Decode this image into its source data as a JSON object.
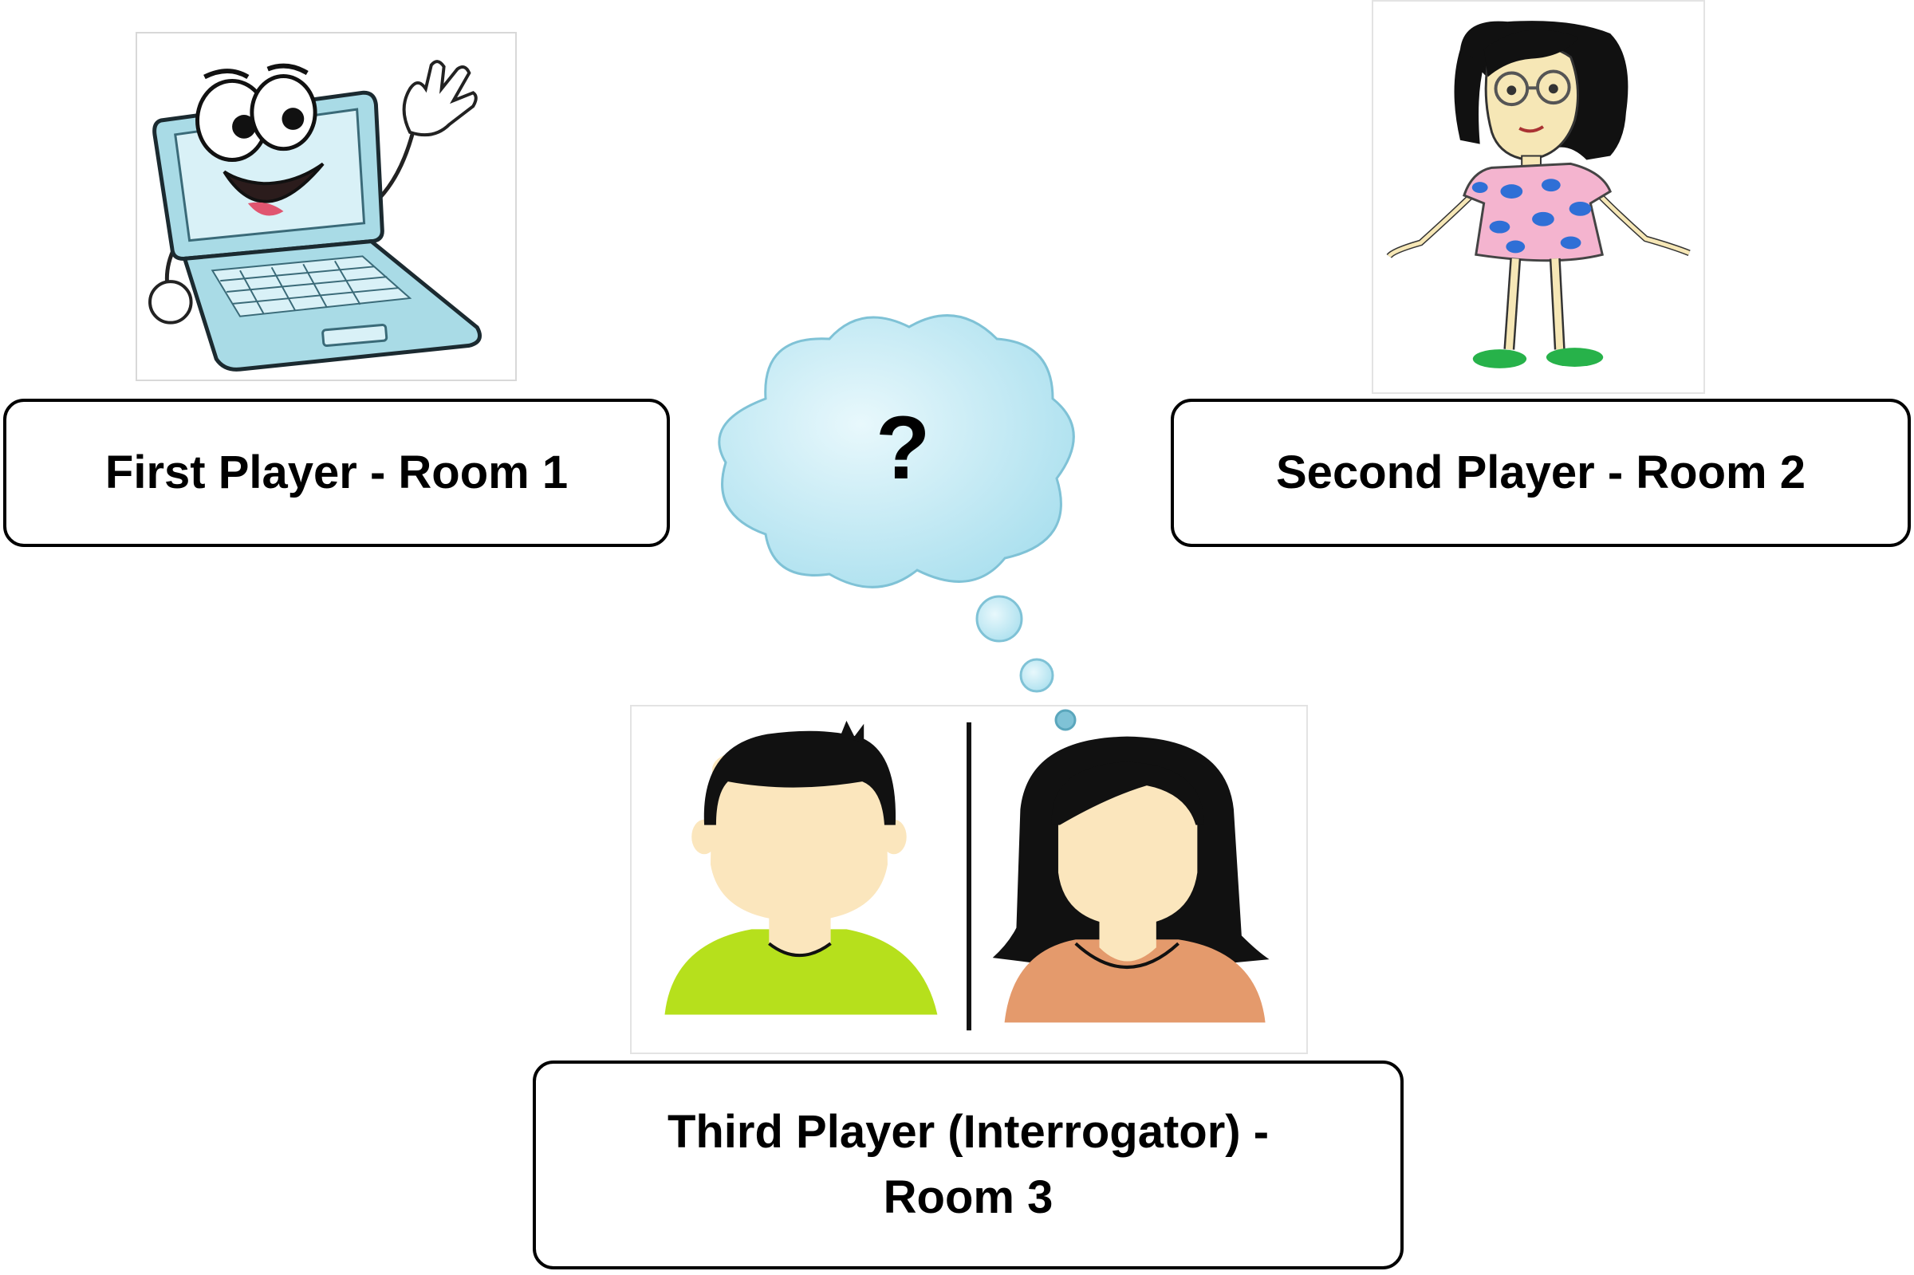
{
  "players": {
    "first": {
      "label": "First Player - Room 1",
      "picture": "waving-laptop-cartoon"
    },
    "second": {
      "label": "Second Player - Room 2",
      "picture": "girl-in-dress-cartoon"
    },
    "third": {
      "label_line1": "Third Player (Interrogator) -",
      "label_line2": "Room 3",
      "picture": "man-and-woman-avatars"
    }
  },
  "thought_bubble": {
    "text": "?",
    "color": "#bfe9f4"
  },
  "colors": {
    "laptop_body": "#a9dbe6",
    "man_shirt": "#b6e01c",
    "woman_shirt": "#e49a6c",
    "skin": "#fbe6bd",
    "hair": "#111111"
  }
}
